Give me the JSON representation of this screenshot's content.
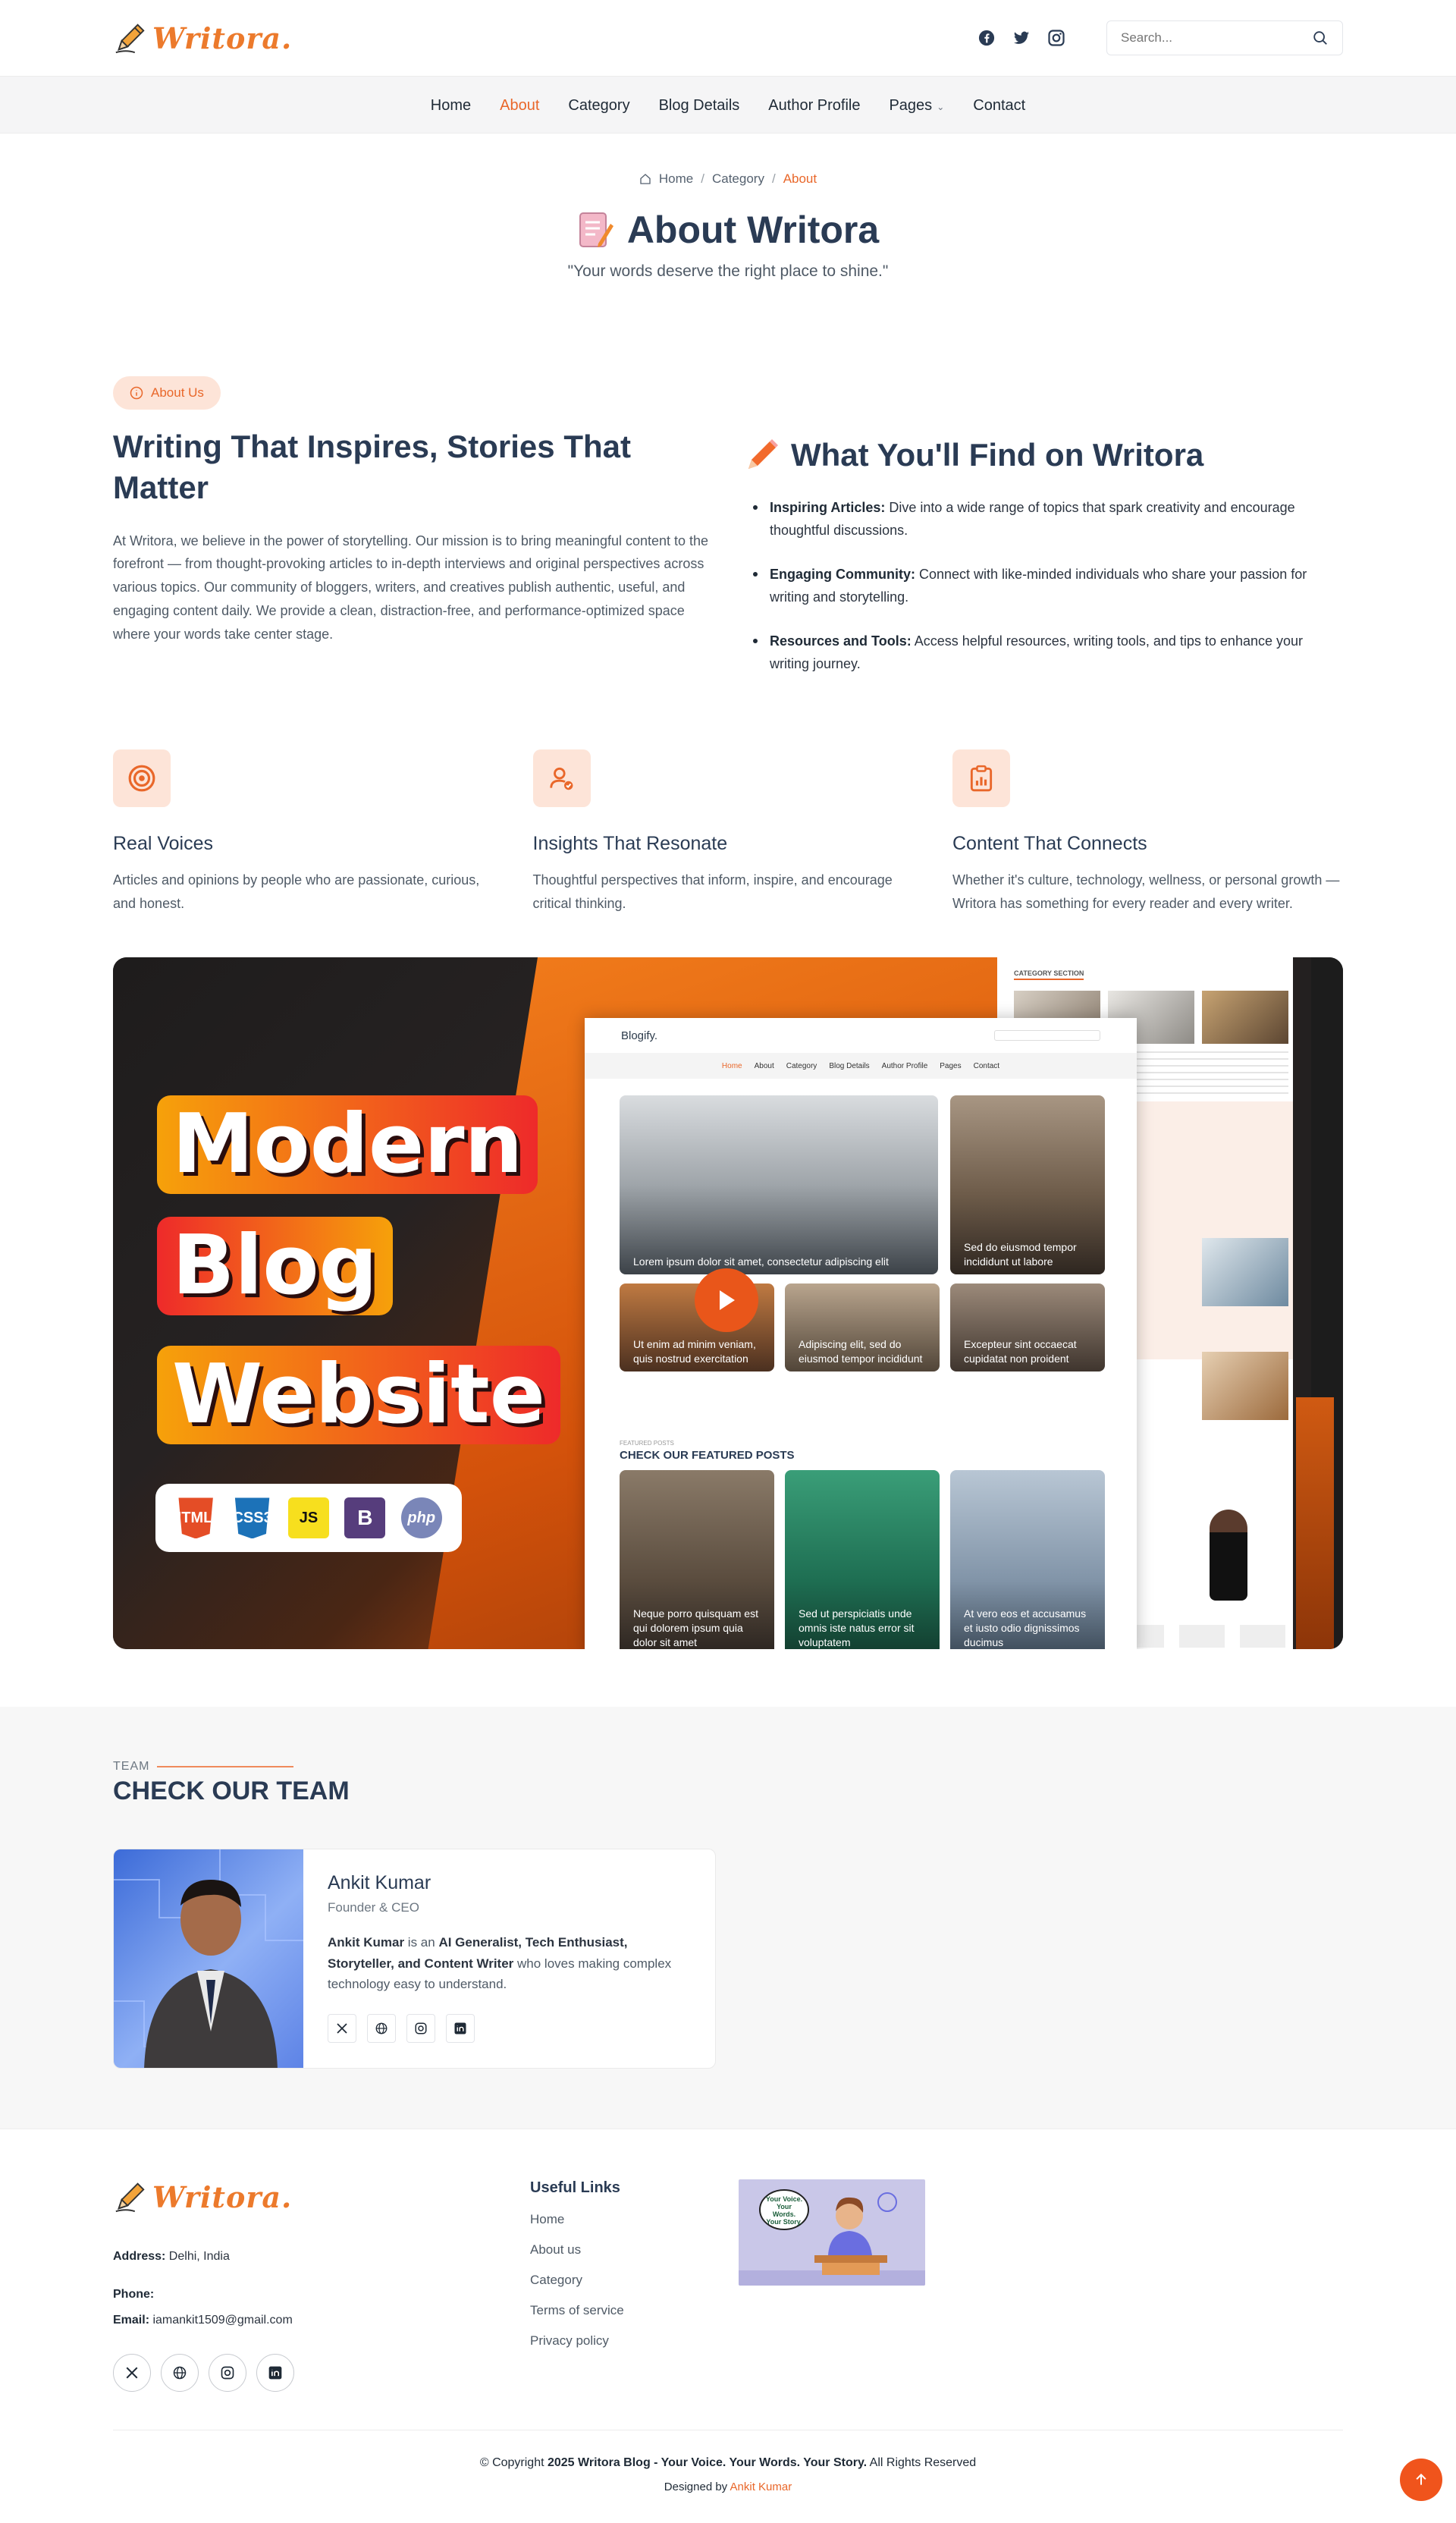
{
  "header": {
    "logo_text": "Writora.",
    "search_placeholder": "Search...",
    "social_icons": [
      "facebook-icon",
      "twitter-icon",
      "instagram-icon"
    ]
  },
  "nav": {
    "items": [
      {
        "label": "Home"
      },
      {
        "label": "About",
        "active": true
      },
      {
        "label": "Category"
      },
      {
        "label": "Blog Details"
      },
      {
        "label": "Author Profile"
      },
      {
        "label": "Pages",
        "dropdown": true
      },
      {
        "label": "Contact"
      }
    ]
  },
  "hero": {
    "breadcrumb": [
      "Home",
      "Category",
      "About"
    ],
    "title": "About Writora",
    "tagline": "\"Your words deserve the right place to shine.\""
  },
  "about": {
    "pill": "About Us",
    "heading": "Writing That Inspires, Stories That Matter",
    "body": "At Writora, we believe in the power of storytelling. Our mission is to bring meaningful content to the forefront — from thought-provoking articles to in-depth interviews and original perspectives across various topics. Our community of bloggers, writers, and creatives publish authentic, useful, and engaging content daily. We provide a clean, distraction-free, and performance-optimized space where your words take center stage.",
    "find_heading": "What You'll Find on Writora",
    "find_items": [
      {
        "title": "Inspiring Articles:",
        "text": " Dive into a wide range of topics that spark creativity and encourage thoughtful discussions."
      },
      {
        "title": "Engaging Community:",
        "text": " Connect with like-minded individuals who share your passion for writing and storytelling."
      },
      {
        "title": "Resources and Tools:",
        "text": " Access helpful resources, writing tools, and tips to enhance your writing journey."
      }
    ]
  },
  "features": [
    {
      "icon": "target-icon",
      "title": "Real Voices",
      "text": "Articles and opinions by people who are passionate, curious, and honest."
    },
    {
      "icon": "user-check-icon",
      "title": "Insights That Resonate",
      "text": "Thoughtful perspectives that inform, inspire, and encourage critical thinking."
    },
    {
      "icon": "clipboard-chart-icon",
      "title": "Content That Connects",
      "text": "Whether it's culture, technology, wellness, or personal growth — Writora has something for every reader and every writer."
    }
  ],
  "banner": {
    "words": [
      "Modern",
      "Blog",
      "Website"
    ],
    "tech": [
      "HTML5",
      "CSS3",
      "JS",
      "B",
      "php"
    ],
    "mock_logo": "Blogify.",
    "mock_nav": [
      "Home",
      "About",
      "Category",
      "Blog Details",
      "Author Profile",
      "Pages",
      "Contact"
    ],
    "mock_tiles": [
      "Lorem ipsum dolor sit amet, consectetur adipiscing elit",
      "Sed do eiusmod tempor incididunt ut labore",
      "Ut enim ad minim veniam, quis nostrud exercitation",
      "Adipiscing elit, sed do eiusmod tempor incididunt",
      "Excepteur sint occaecat cupidatat non proident"
    ],
    "mock_feat_label": "FEATURED POSTS",
    "mock_feat_title": "CHECK OUR FEATURED POSTS",
    "mock_feat_posts": [
      "Neque porro quisquam est qui dolorem ipsum quia dolor sit amet",
      "Sed ut perspiciatis unde omnis iste natus error sit voluptatem",
      "At vero eos et accusamus et iusto odio dignissimos ducimus"
    ],
    "mock2_label": "CATEGORY SECTION"
  },
  "team": {
    "label": "TEAM",
    "heading": "CHECK OUR TEAM",
    "member": {
      "name": "Ankit Kumar",
      "role": "Founder & CEO",
      "bio_name": "Ankit Kumar",
      "bio_mid": " is an ",
      "bio_bold": "AI Generalist, Tech Enthusiast, Storyteller, and Content Writer",
      "bio_end": " who loves making complex technology easy to understand."
    }
  },
  "footer": {
    "logo_text": "Writora.",
    "address_label": "Address:",
    "address": " Delhi, India",
    "phone_label": "Phone:",
    "email_label": "Email:",
    "email": " iamankit1509@gmail.com",
    "links_heading": "Useful Links",
    "links": [
      "Home",
      "About us",
      "Category",
      "Terms of service",
      "Privacy policy"
    ],
    "image_text": "Your Voice. Your Words. Your Story.",
    "copyright_prefix": "© Copyright ",
    "copyright_bold": "2025 Writora Blog - Your Voice. Your Words. Your Story.",
    "copyright_suffix": " All Rights Reserved",
    "designed_by": "Designed by ",
    "designer": "Ankit Kumar"
  },
  "colors": {
    "accent": "#e9672a",
    "heading": "#2a3b54",
    "pill_bg": "#fde4d8",
    "team_bg": "#f7f7f7"
  }
}
